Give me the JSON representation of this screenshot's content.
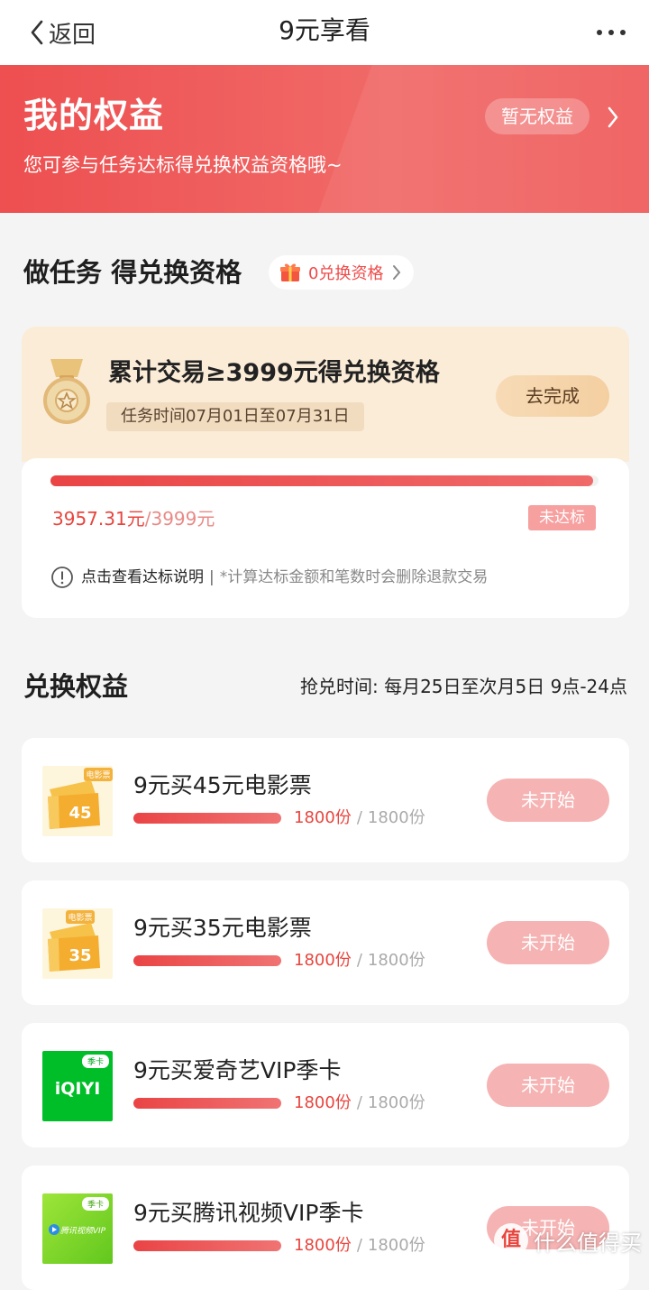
{
  "nav": {
    "back_label": "返回",
    "title": "9元享看"
  },
  "banner": {
    "title": "我的权益",
    "subtitle": "您可参与任务达标得兑换权益资格哦~",
    "status_pill": "暂无权益"
  },
  "task_section": {
    "title": "做任务 得兑换资格",
    "qualification_pill": "0兑换资格",
    "task": {
      "title": "累计交易≥3999元得兑换资格",
      "time": "任务时间07月01日至07月31日",
      "button": "去完成",
      "progress_fraction": 0.9896,
      "current": "3957.31元",
      "separator": "/",
      "target": "3999元",
      "status": "未达标",
      "info_link": "点击查看达标说明",
      "info_sep": "|",
      "info_note": "*计算达标金额和笔数时会删除退款交易"
    }
  },
  "exchange_section": {
    "title": "兑换权益",
    "time_label": "抢兑时间:",
    "time_value": "每月25日至次月5日 9点-24点",
    "items": [
      {
        "name": "9元买45元电影票",
        "remaining": "1800份",
        "sep": "/",
        "total": "1800份",
        "button": "未开始",
        "thumb_tag": "电影票",
        "thumb_value": "45",
        "progress_fraction": 1.0
      },
      {
        "name": "9元买35元电影票",
        "remaining": "1800份",
        "sep": "/",
        "total": "1800份",
        "button": "未开始",
        "thumb_tag": "电影票",
        "thumb_value": "35",
        "progress_fraction": 1.0
      },
      {
        "name": "9元买爱奇艺VIP季卡",
        "remaining": "1800份",
        "sep": "/",
        "total": "1800份",
        "button": "未开始",
        "thumb_tag": "季卡",
        "thumb_value": "iQIYI",
        "progress_fraction": 1.0
      },
      {
        "name": "9元买腾讯视频VIP季卡",
        "remaining": "1800份",
        "sep": "/",
        "total": "1800份",
        "button": "未开始",
        "thumb_tag": "季卡",
        "thumb_value": "腾讯视频VIP",
        "progress_fraction": 1.0
      }
    ]
  },
  "watermark": {
    "icon": "值",
    "text": "什么值得买"
  },
  "colors": {
    "brand_red": "#ee4f50",
    "task_bg": "#fbecd8",
    "button_disabled": "#f6b3b3"
  }
}
